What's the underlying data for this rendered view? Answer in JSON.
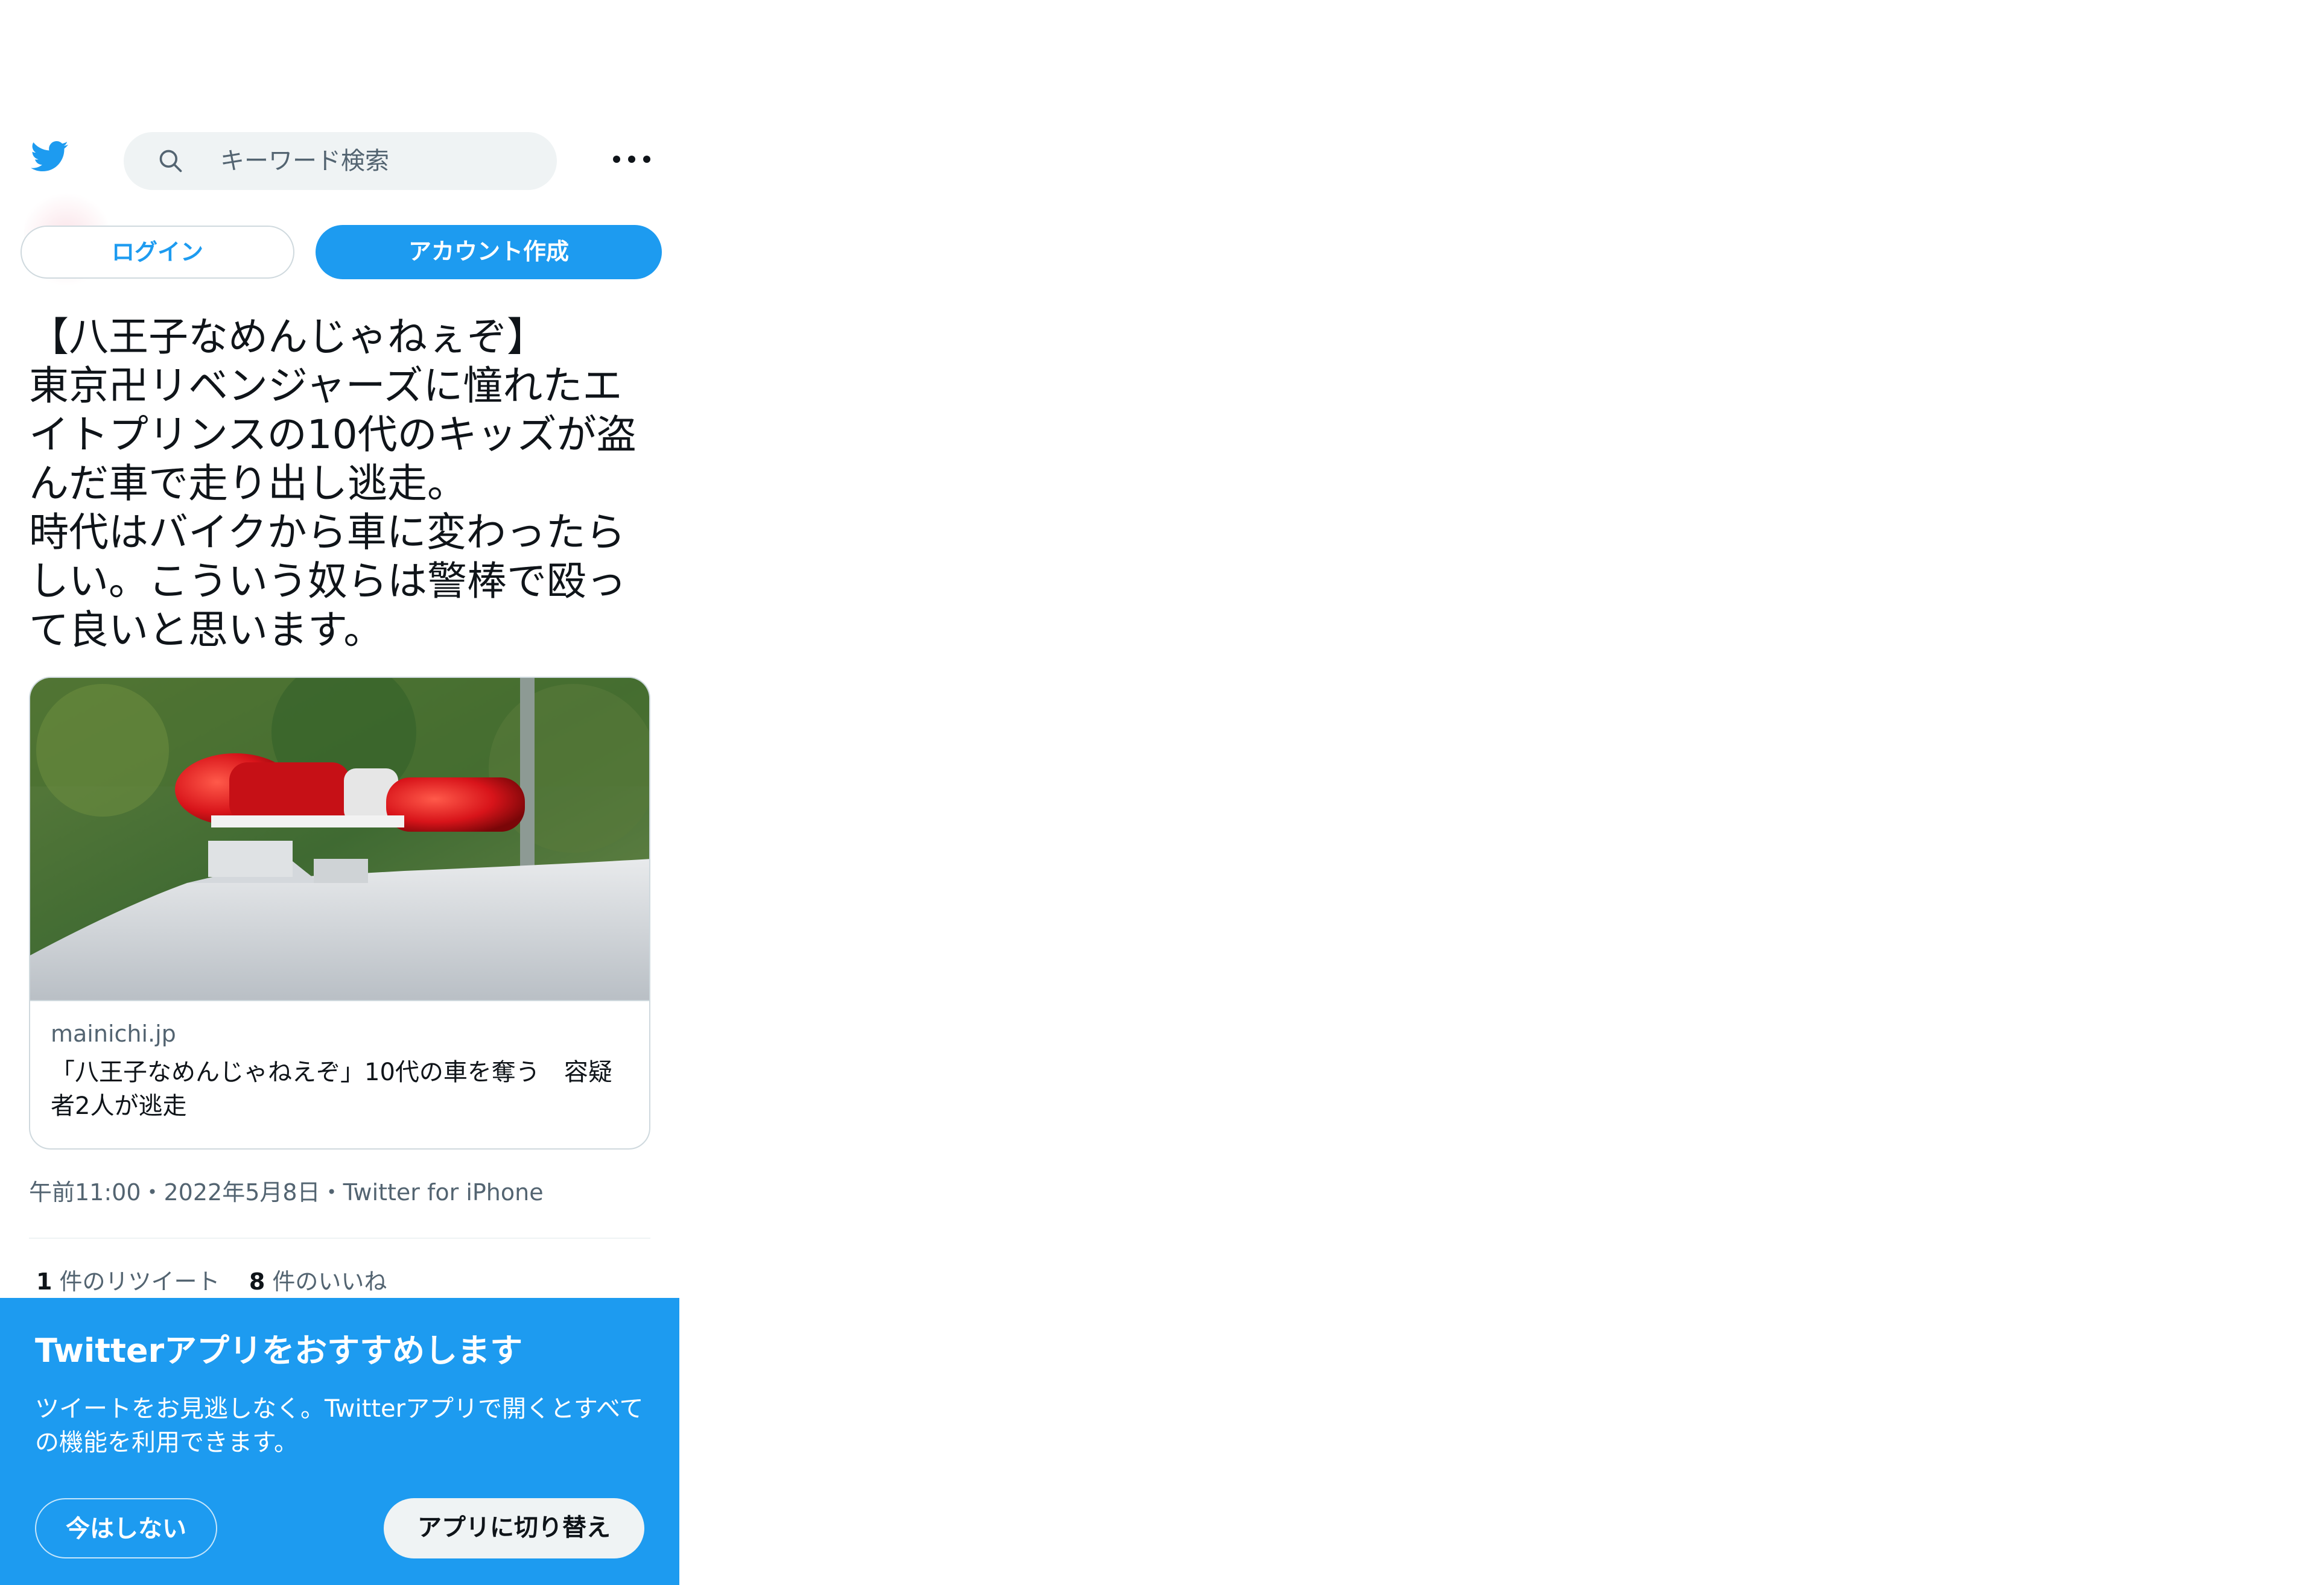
{
  "header": {
    "logo_icon": "twitter-bird-icon",
    "search_placeholder": "キーワード検索",
    "search_icon": "search-icon",
    "more_icon": "more-horizontal-icon"
  },
  "auth": {
    "login_label": "ログイン",
    "signup_label": "アカウント作成"
  },
  "tweet": {
    "text": "【八王子なめんじゃねぇぞ】\n東京卍リベンジャーズに憧れたエイトプリンスの10代のキッズが盗んだ車で走り出し逃走。\n時代はバイクから車に変わったらしい。こういう奴らは警棒で殴って良いと思います。",
    "card": {
      "image_alt": "police-car-siren-light",
      "domain": "mainichi.jp",
      "title": "「八王子なめんじゃねえぞ」10代の車を奪う　容疑者2人が逃走"
    },
    "meta": "午前11:00・2022年5月8日・Twitter for iPhone",
    "stats": {
      "retweet_count": "1",
      "retweet_label": " 件のリツイート",
      "like_count": "8",
      "like_label": " 件のいいね"
    }
  },
  "app_banner": {
    "title": "Twitterアプリをおすすめします",
    "body": "ツイートをお見逃しなく。Twitterアプリで開くとすべての機能を利用できます。",
    "not_now_label": "今はしない",
    "switch_label": "アプリに切り替え"
  },
  "colors": {
    "brand_blue": "#1d9bf0",
    "text_primary": "#0f1419",
    "text_secondary": "#536471",
    "border": "#cfd9de",
    "search_bg": "#eff3f4"
  }
}
